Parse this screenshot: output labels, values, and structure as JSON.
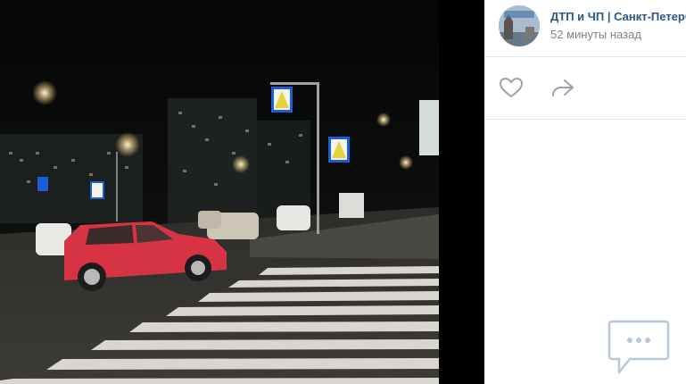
{
  "post": {
    "author": "ДТП и ЧП | Санкт-Петербург",
    "time": "52 минуты назад",
    "avatar_text": "ДТП и ЧП Санкт-Петербург"
  },
  "icons": {
    "like": "heart-icon",
    "share": "share-arrow-icon",
    "comments": "comment-bubble-icon"
  },
  "colors": {
    "author_link": "#2a5885",
    "secondary_text": "#828282",
    "divider": "#e7e8ec",
    "icon": "#99a2ad",
    "comments_icon": "#b8c8da"
  }
}
